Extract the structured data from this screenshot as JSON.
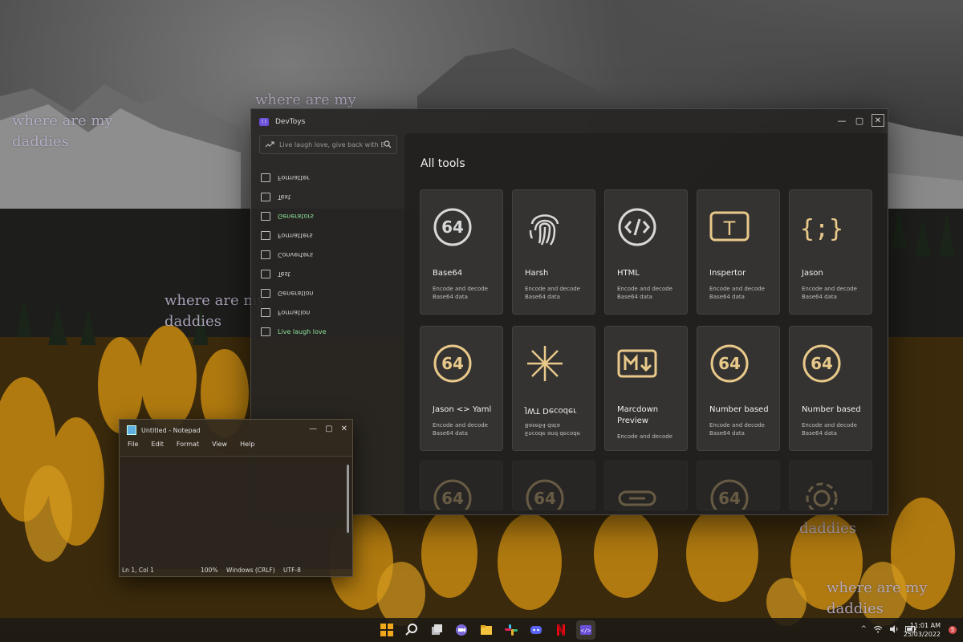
{
  "wallpaper_text": [
    {
      "text": "where are my\ndaddies"
    },
    {
      "text": "where are my"
    },
    {
      "text": "where are my\ndaddies"
    },
    {
      "text": "daddies"
    },
    {
      "text": "where are my\ndaddies"
    }
  ],
  "devtoys": {
    "title": "DevToys",
    "search_placeholder": "Live laugh love, give back with Bing",
    "nav_items": [
      {
        "label": "Formatter",
        "flipped": true,
        "icon": "format-icon"
      },
      {
        "label": "Text",
        "flipped": true,
        "icon": "text-icon"
      },
      {
        "label": "Generators",
        "flipped": true,
        "icon": "generator-icon"
      },
      {
        "label": "Formatters",
        "flipped": true,
        "icon": "format-icon"
      },
      {
        "label": "Converters",
        "flipped": true,
        "icon": "converter-icon"
      },
      {
        "label": "Test",
        "flipped": true,
        "icon": "text-icon"
      },
      {
        "label": "Generation",
        "flipped": true,
        "icon": "generator-icon"
      },
      {
        "label": "Formation",
        "flipped": true,
        "icon": "format-icon"
      },
      {
        "label": "Live laugh love",
        "flipped": false,
        "icon": "converter-icon"
      }
    ],
    "heading": "All tools",
    "cards": [
      {
        "name": "Base64",
        "desc": "Encode and decode Base64 data",
        "icon": "base64-icon"
      },
      {
        "name": "Harsh",
        "desc": "Encode and decode Base64 data",
        "icon": "fingerprint-icon"
      },
      {
        "name": "HTML",
        "desc": "Encode and decode Base64 data",
        "icon": "html-code-icon"
      },
      {
        "name": "Inspertor",
        "desc": "Encode and decode Base64 data",
        "icon": "text-inspector-icon"
      },
      {
        "name": "Jason",
        "desc": "Encode and decode Base64 data",
        "icon": "json-braces-icon"
      },
      {
        "name": "Jason <> Yaml",
        "desc": "Encode and decode Base64 data",
        "icon": "base64-icon"
      },
      {
        "name": "JWT Decoder",
        "desc": "Encode and decode Base64 data",
        "icon": "jwt-sparkle-icon",
        "flipped": true
      },
      {
        "name": "Marcdown Preview",
        "desc": "Encode and decode",
        "icon": "markdown-icon"
      },
      {
        "name": "Number based",
        "desc": "Encode and decode Base64 data",
        "icon": "base64-icon"
      },
      {
        "name": "Number based",
        "desc": "Encode and decode Base64 data",
        "icon": "base64-icon"
      }
    ],
    "faded_cards": [
      "base64-icon",
      "base64-icon",
      "link-icon",
      "base64-icon",
      "gear-icon"
    ]
  },
  "notepad": {
    "title": "Untitled - Notepad",
    "menu": [
      "File",
      "Edit",
      "Format",
      "View",
      "Help"
    ],
    "status": {
      "position": "Ln 1, Col 1",
      "zoom": "100%",
      "line_ending": "Windows (CRLF)",
      "encoding": "UTF-8"
    }
  },
  "taskbar": {
    "icons": [
      "windows-start-icon",
      "search-icon",
      "task-view-icon",
      "teams-chat-icon",
      "file-explorer-icon",
      "slack-icon",
      "discord-icon",
      "netflix-icon",
      "devtoys-icon"
    ],
    "tray": {
      "chevron": "^"
    },
    "time": "11:01 AM",
    "date": "25/03/2022",
    "notification_count": "5"
  },
  "colors": {
    "accent_gold": "#e8c98a",
    "accent_green": "#8ee39a",
    "devtoys_purple": "#6b4fd8"
  }
}
